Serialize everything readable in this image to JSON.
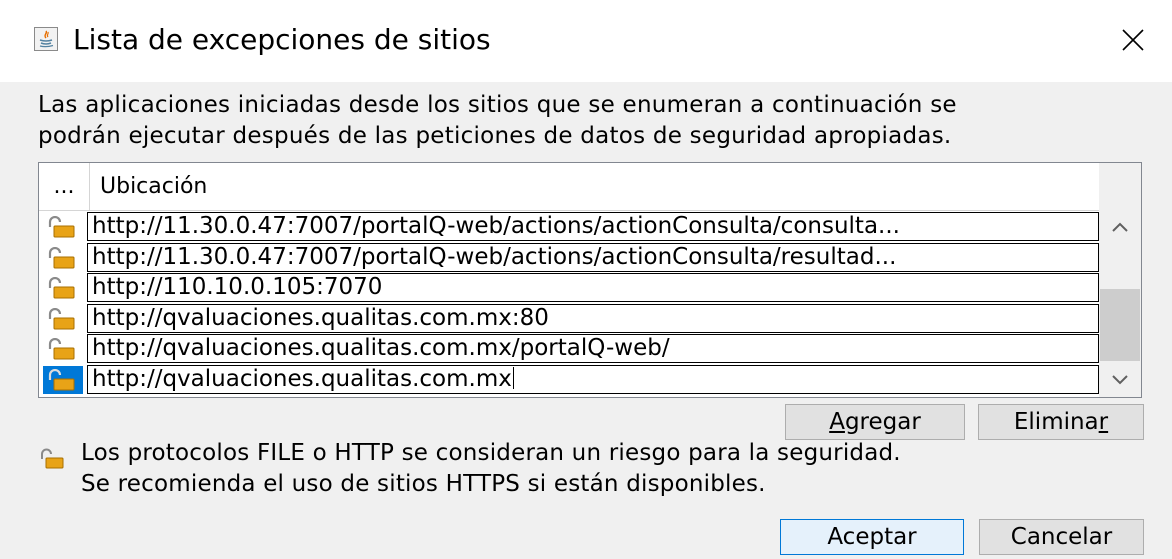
{
  "window": {
    "title": "Lista de excepciones de sitios",
    "app_icon": "java-icon",
    "close_icon": "close-icon"
  },
  "description": {
    "line1": "Las aplicaciones iniciadas desde los sitios que se enumeran a continuación se",
    "line2": "podrán ejecutar después de las peticiones de datos de seguridad apropiadas."
  },
  "table": {
    "columns": [
      "...",
      "Ubicación"
    ],
    "rows": [
      {
        "icon": "unlocked-padlock-icon",
        "url": "http://11.30.0.47:7007/portalQ-web/actions/actionConsulta/consulta..."
      },
      {
        "icon": "unlocked-padlock-icon",
        "url": "http://11.30.0.47:7007/portalQ-web/actions/actionConsulta/resultad..."
      },
      {
        "icon": "unlocked-padlock-icon",
        "url": "http://110.10.0.105:7070"
      },
      {
        "icon": "unlocked-padlock-icon",
        "url": "http://qvaluaciones.qualitas.com.mx:80"
      },
      {
        "icon": "unlocked-padlock-icon",
        "url": "http://qvaluaciones.qualitas.com.mx/portalQ-web/"
      },
      {
        "icon": "unlocked-padlock-icon",
        "url": "http://qvaluaciones.qualitas.com.mx",
        "selected": true,
        "editing": true
      }
    ],
    "scroll_up_icon": "chevron-up-icon",
    "scroll_down_icon": "chevron-down-icon"
  },
  "buttons": {
    "add": {
      "prefix": "",
      "mnemonic": "A",
      "suffix": "gregar"
    },
    "remove": {
      "prefix": "Elimina",
      "mnemonic": "r",
      "suffix": ""
    },
    "ok": "Aceptar",
    "cancel": "Cancelar"
  },
  "warning": {
    "icon": "unlocked-padlock-icon",
    "line1": "Los protocolos FILE o HTTP se consideran un riesgo para la seguridad.",
    "line2": "Se recomienda el uso de sitios HTTPS si están disponibles."
  },
  "colors": {
    "selection": "#0078d7",
    "dialog_background": "#f0f0f0",
    "padlock": "#e8a317"
  }
}
